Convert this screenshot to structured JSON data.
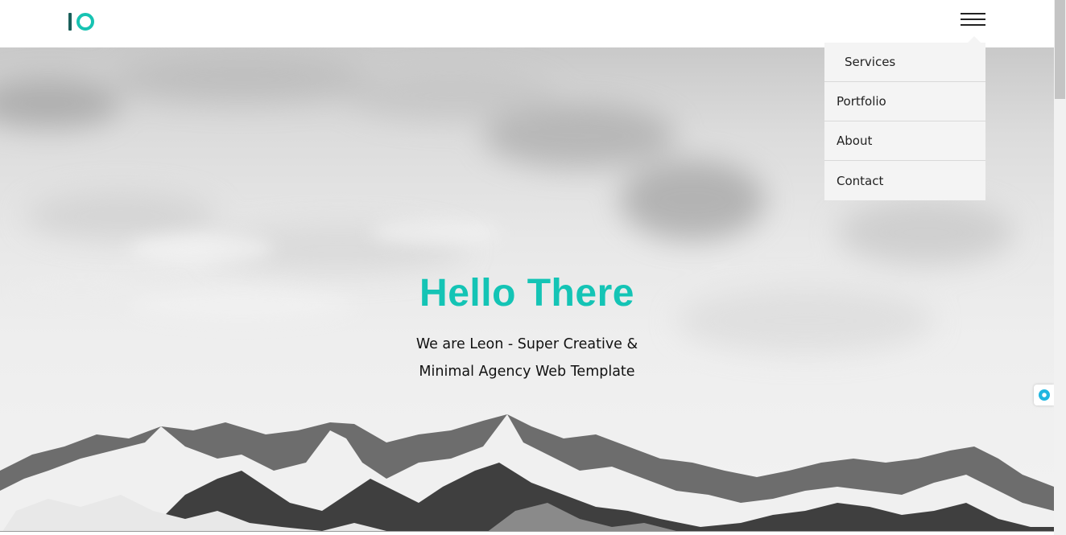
{
  "navbar": {
    "logo_icon": "io-logo",
    "menu_icon": "hamburger-menu-icon"
  },
  "menu": {
    "items": [
      {
        "label": "Services"
      },
      {
        "label": "Portfolio"
      },
      {
        "label": "About"
      },
      {
        "label": "Contact"
      }
    ]
  },
  "hero": {
    "title": "Hello There",
    "subtitle_line1": "We are Leon - Super Creative &",
    "subtitle_line2": "Minimal Agency Web Template"
  },
  "colors": {
    "accent": "#14c4b5",
    "logo_dark": "#1a5f5a",
    "text": "#111111",
    "menu_bg": "#f4f4f4"
  },
  "widget": {
    "icon": "chat-bubble-icon"
  }
}
